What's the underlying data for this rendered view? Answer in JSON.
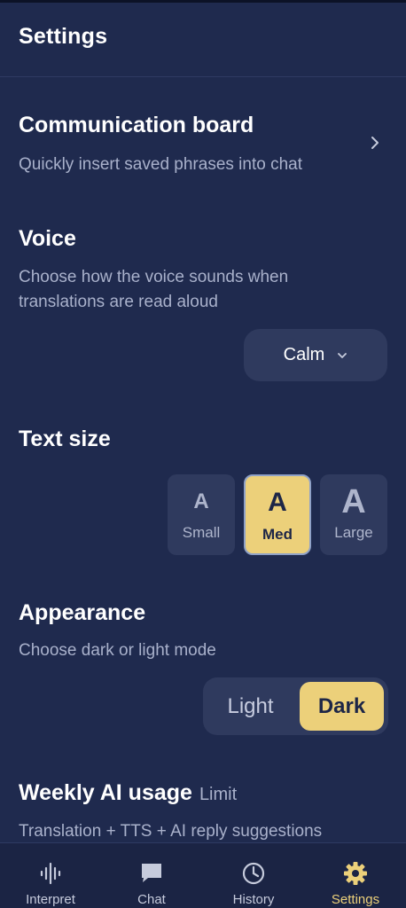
{
  "header": {
    "title": "Settings"
  },
  "communication": {
    "title": "Communication board",
    "subtitle": "Quickly insert saved phrases into chat"
  },
  "voice": {
    "title": "Voice",
    "subtitle_line1": "Choose how the voice sounds when",
    "subtitle_line2": "translations are read aloud",
    "selected": "Calm"
  },
  "text_size": {
    "title": "Text size",
    "options": [
      {
        "glyph": "A",
        "label": "Small"
      },
      {
        "glyph": "A",
        "label": "Med"
      },
      {
        "glyph": "A",
        "label": "Large"
      }
    ],
    "selected": "Med"
  },
  "appearance": {
    "title": "Appearance",
    "subtitle": "Choose dark or light mode",
    "options": [
      "Light",
      "Dark"
    ],
    "selected": "Dark"
  },
  "usage": {
    "title": "Weekly AI usage",
    "limit_label": "Limit",
    "subtitle": "Translation + TTS + AI reply suggestions"
  },
  "nav": {
    "items": [
      {
        "label": "Interpret",
        "icon": "waveform-icon"
      },
      {
        "label": "Chat",
        "icon": "chat-bubble-icon"
      },
      {
        "label": "History",
        "icon": "clock-icon"
      },
      {
        "label": "Settings",
        "icon": "gear-icon"
      }
    ],
    "active": "Settings"
  },
  "colors": {
    "background": "#1f2a4e",
    "card": "#2f3a5e",
    "accent": "#ecd07a",
    "muted_text": "#a9b1cb"
  }
}
